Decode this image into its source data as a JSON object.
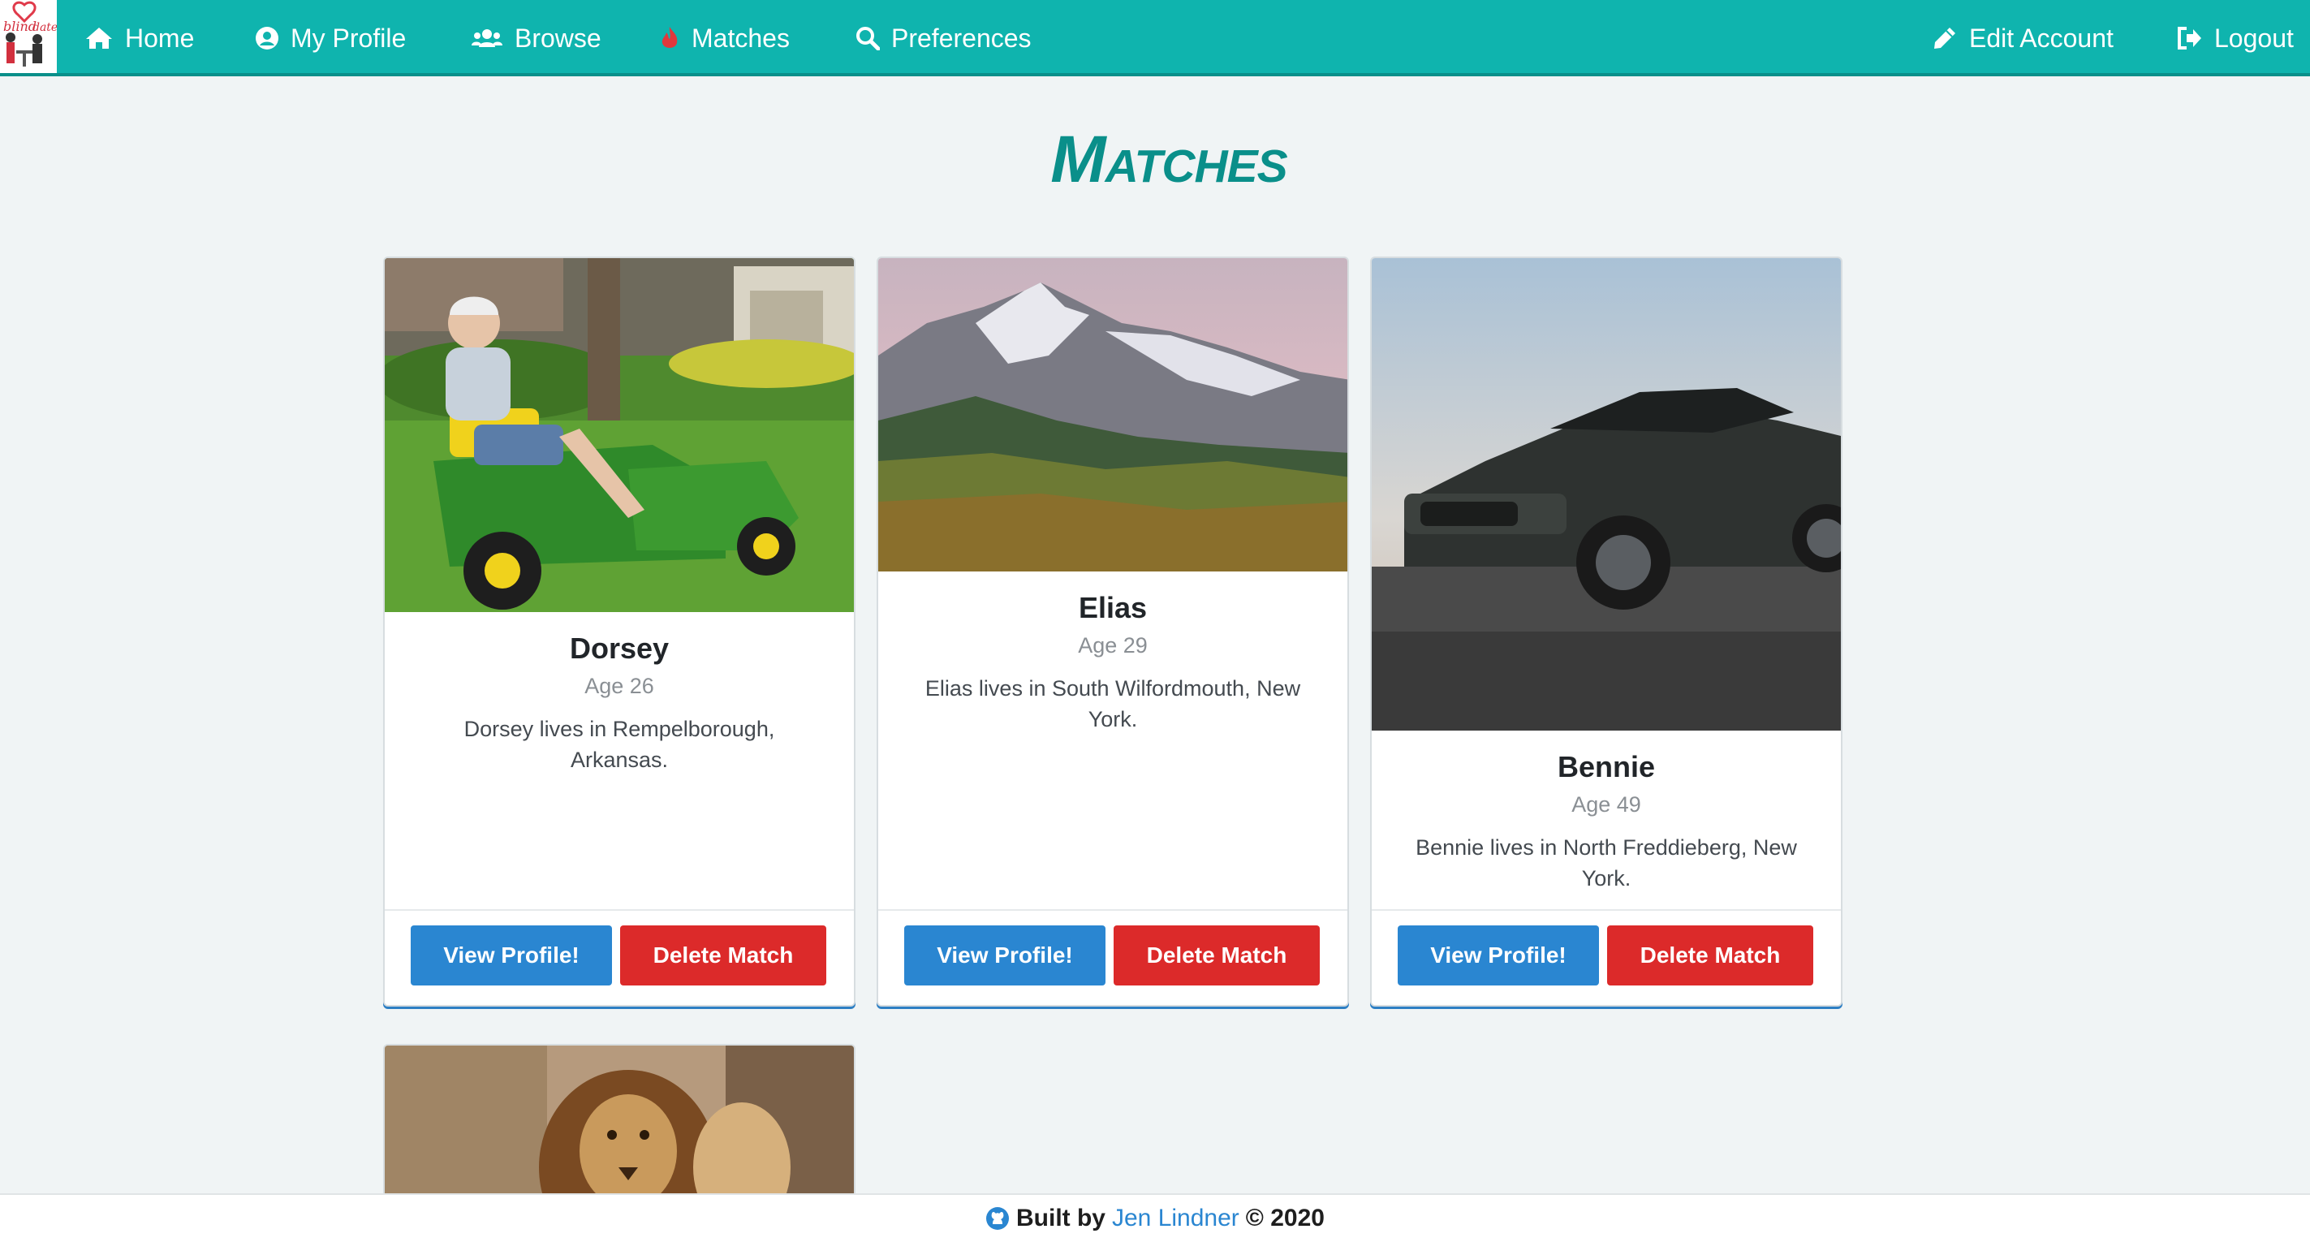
{
  "nav": {
    "home": "Home",
    "profile": "My Profile",
    "browse": "Browse",
    "matches": "Matches",
    "preferences": "Preferences",
    "edit_account": "Edit Account",
    "logout": "Logout"
  },
  "colors": {
    "brand": "#0fb4ae",
    "title": "#0a8f8a",
    "view_button": "#2a86d1",
    "delete_button": "#dc2a2a"
  },
  "page": {
    "title": "Matches"
  },
  "matches": [
    {
      "name": "Dorsey",
      "age": "Age 26",
      "location": "Dorsey lives in Rempelborough, Arkansas.",
      "photo": "man-on-lawn-mower-photo"
    },
    {
      "name": "Elias",
      "age": "Age 29",
      "location": "Elias lives in South Wilfordmouth, New York.",
      "photo": "mountain-landscape-photo"
    },
    {
      "name": "Bennie",
      "age": "Age 49",
      "location": "Bennie lives in North Freddieberg, New York.",
      "photo": "sports-car-photo"
    },
    {
      "name": "",
      "age": "",
      "location": "",
      "photo": "lion-photo"
    }
  ],
  "buttons": {
    "view": "View Profile!",
    "delete": "Delete Match"
  },
  "footer": {
    "prefix": "Built by",
    "author": "Jen Lindner",
    "suffix": "© 2020"
  }
}
